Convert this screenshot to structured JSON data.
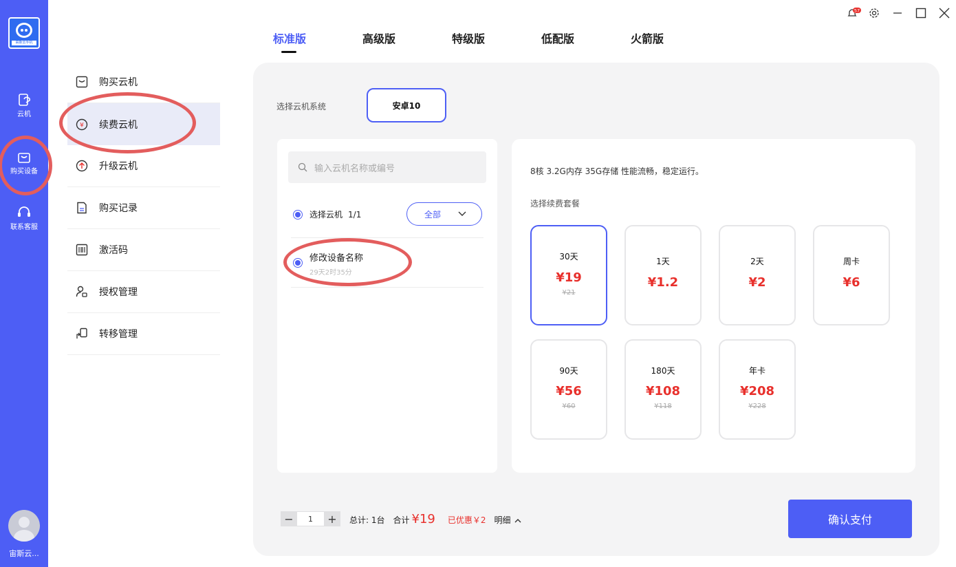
{
  "app": {
    "logo_text": "由斯云手机",
    "colors": {
      "accent": "#4d5ef5",
      "price": "#e8302c",
      "annotation": "#e35d5d"
    }
  },
  "rail": {
    "items": [
      {
        "label": "云机",
        "icon": "cloud-phone-icon"
      },
      {
        "label": "购买设备",
        "icon": "shopping-bag-icon"
      },
      {
        "label": "联系客服",
        "icon": "headset-icon"
      }
    ],
    "user_name": "宙斯云..."
  },
  "menu": {
    "items": [
      {
        "label": "购买云机",
        "icon": "bag-icon"
      },
      {
        "label": "续费云机",
        "icon": "yen-coin-icon"
      },
      {
        "label": "升级云机",
        "icon": "upgrade-arrow-icon"
      },
      {
        "label": "购买记录",
        "icon": "document-icon"
      },
      {
        "label": "激活码",
        "icon": "barcode-icon"
      },
      {
        "label": "授权管理",
        "icon": "user-lock-icon"
      },
      {
        "label": "转移管理",
        "icon": "transfer-icon"
      }
    ],
    "active": "续费云机"
  },
  "tabs": [
    "标准版",
    "高级版",
    "特级版",
    "低配版",
    "火箭版"
  ],
  "active_tab": "标准版",
  "system": {
    "label": "选择云机系统",
    "option": "安卓10"
  },
  "device_list": {
    "search_placeholder": "输入云机名称或编号",
    "select_label": "选择云机",
    "select_count": "1/1",
    "filter_value": "全部",
    "devices": [
      {
        "name": "修改设备名称",
        "remaining": "29天2时35分"
      }
    ]
  },
  "packages": {
    "spec": "8核 3.2G内存 35G存储 性能流畅，稳定运行。",
    "label": "选择续费套餐",
    "items": [
      {
        "name": "30天",
        "price": "¥19",
        "original": "¥21"
      },
      {
        "name": "1天",
        "price": "¥1.2",
        "original": ""
      },
      {
        "name": "2天",
        "price": "¥2",
        "original": ""
      },
      {
        "name": "周卡",
        "price": "¥6",
        "original": ""
      },
      {
        "name": "90天",
        "price": "¥56",
        "original": "¥60"
      },
      {
        "name": "180天",
        "price": "¥108",
        "original": "¥118"
      },
      {
        "name": "年卡",
        "price": "¥208",
        "original": "¥228"
      }
    ],
    "selected": "30天"
  },
  "footer": {
    "quantity": "1",
    "minus": "−",
    "plus": "+",
    "total_units": "总计: 1台",
    "sum_label": "合计",
    "sum_value": "¥19",
    "discount": "已优惠￥2",
    "details": "明细",
    "pay_button": "确认支付"
  },
  "notifications": {
    "badge": "57"
  }
}
